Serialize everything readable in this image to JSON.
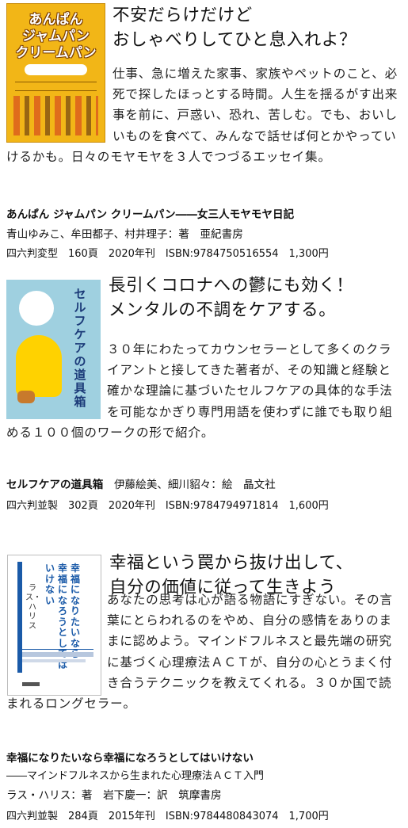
{
  "books": [
    {
      "headline": [
        "不安だらけだけど",
        "おしゃべりしてひと息入れよ？"
      ],
      "description": "仕事、急に増えた家事、家族やペットのこと、必死で探したほっとする時間。人生を揺るがす出来事を前に、戸惑い、恐れ、苦しむ。でも、おいしいものを食べて、みんなで話せば何とかやっていけるかも。日々のモヤモヤを３人でつづるエッセイ集。",
      "title": "あんぱん ジャムパン クリームパン――女三人モヤモヤ日記",
      "credits": "青山ゆみこ、牟田都子、村井理子：著　亜紀書房",
      "specs": "四六判変型　160頁　2020年刊　ISBN:9784750516554　1,300円",
      "cover": {
        "title_lines": [
          "あんぱん",
          "ジャムパン",
          "クリームパン"
        ]
      }
    },
    {
      "headline": [
        "長引くコロナへの鬱にも効く！",
        "メンタルの不調をケアする。"
      ],
      "description": "３０年にわたってカウンセラーとして多くのクライアントと接してきた著者が、その知識と経験と確かな理論に基づいたセルフケアの具体的な手法を可能なかぎり専門用語を使わずに誰でも取り組める１００個のワークの形で紹介。",
      "title": "セルフケアの道具箱",
      "credits": "伊藤絵美、細川貂々：絵　晶文社",
      "specs": "四六判並製　302頁　2020年刊　ISBN:9784794971814　1,600円",
      "cover": {
        "title_vertical": "セルフケアの道具箱"
      }
    },
    {
      "headline": [
        "幸福という罠から抜け出して、",
        "自分の価値に従って生きよう"
      ],
      "description": "あなたの思考は心が語る物語にすぎない。その言葉にとらわれるのをやめ、自分の感情をありのままに認めよう。マインドフルネスと最先端の研究に基づく心理療法ＡＣＴが、自分の心とうまく付き合うテクニックを教えてくれる。３０か国で読まれるロングセラー。",
      "title": "幸福になりたいなら幸福になろうとしてはいけない",
      "subtitle": "――マインドフルネスから生まれた心理療法ＡＣＴ入門",
      "credits": "ラス・ハリス：著　岩下慶一：訳　筑摩書房",
      "specs": "四六判並製　284頁　2015年刊　ISBN:9784480843074　1,700円",
      "cover": {
        "title_col1": "幸福になりたいなら",
        "title_col2": "幸福になろうとしては",
        "title_col3": "いけない",
        "author_col": "ラス・ハリス"
      }
    }
  ],
  "colors": {
    "cover1_bg": "#f2b617",
    "cover2_bg": "#9fd0e0",
    "cover3_accent": "#1a5aa8"
  }
}
